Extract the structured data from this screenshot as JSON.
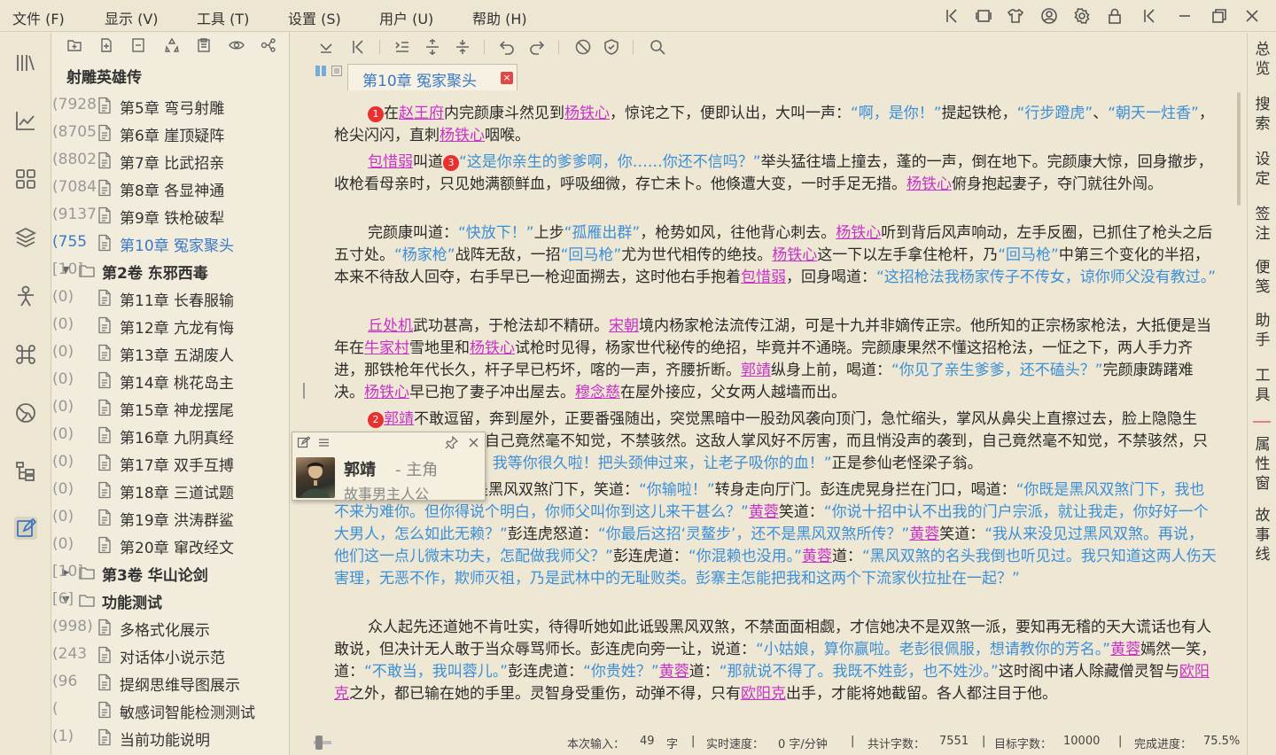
{
  "menu": [
    "文件 (F)",
    "显示 (V)",
    "工具 (T)",
    "设置 (S)",
    "用户 (U)",
    "帮助 (H)"
  ],
  "tree": {
    "title": "射雕英雄传",
    "rows": [
      {
        "label": "第5章 弯弓射雕",
        "count": "(7928",
        "type": "chapter"
      },
      {
        "label": "第6章 崖顶疑阵",
        "count": "(8705",
        "type": "chapter"
      },
      {
        "label": "第7章 比武招亲",
        "count": "(8802",
        "type": "chapter"
      },
      {
        "label": "第8章 各显神通",
        "count": "(7084",
        "type": "chapter"
      },
      {
        "label": "第9章 铁枪破犁",
        "count": "(9137",
        "type": "chapter"
      },
      {
        "label": "第10章 冤家聚头",
        "count": "(755",
        "type": "chapter",
        "selected": true
      },
      {
        "label": "第2卷 东邪西毒",
        "count": "[10]",
        "type": "volume",
        "expanded": true
      },
      {
        "label": "第11章 长春服输",
        "count": "(0)",
        "type": "chapter"
      },
      {
        "label": "第12章 亢龙有悔",
        "count": "(0)",
        "type": "chapter"
      },
      {
        "label": "第13章 五湖废人",
        "count": "(0)",
        "type": "chapter"
      },
      {
        "label": "第14章 桃花岛主",
        "count": "(0)",
        "type": "chapter"
      },
      {
        "label": "第15章 神龙摆尾",
        "count": "(0)",
        "type": "chapter"
      },
      {
        "label": "第16章 九阴真经",
        "count": "(0)",
        "type": "chapter"
      },
      {
        "label": "第17章 双手互搏",
        "count": "(0)",
        "type": "chapter"
      },
      {
        "label": "第18章 三道试题",
        "count": "(0)",
        "type": "chapter"
      },
      {
        "label": "第19章 洪涛群鲨",
        "count": "(0)",
        "type": "chapter"
      },
      {
        "label": "第20章 窜改经文",
        "count": "(0)",
        "type": "chapter"
      },
      {
        "label": "第3卷 华山论剑",
        "count": "[10]",
        "type": "volume",
        "expanded": false
      },
      {
        "label": "功能测试",
        "count": "[6]",
        "type": "volume",
        "expanded": true
      },
      {
        "label": "多格式化展示",
        "count": "(998)",
        "type": "chapter"
      },
      {
        "label": "对话体小说示范",
        "count": "(243",
        "type": "chapter"
      },
      {
        "label": "提纲思维导图展示",
        "count": "(96",
        "type": "chapter"
      },
      {
        "label": "敏感词智能检测测试",
        "count": "(",
        "type": "chapter"
      },
      {
        "label": "当前功能说明",
        "count": "(1)",
        "type": "chapter"
      }
    ]
  },
  "character_card": {
    "name": "郭靖",
    "role": "- 主角",
    "desc": "故事男主人公"
  },
  "tab": {
    "label": "第10章 冤家聚头",
    "close": "×"
  },
  "editor": {
    "paragraphs": [
      [
        [
          "b",
          "1"
        ],
        [
          "t",
          "在"
        ],
        [
          "n",
          "赵王府"
        ],
        [
          "t",
          "内完颜康斗然见到"
        ],
        [
          "n",
          "杨铁心"
        ],
        [
          "t",
          "，惊诧之下，便即认出，大叫一声："
        ],
        [
          "d",
          "“啊，是你！”"
        ],
        [
          "t",
          "提起铁枪，"
        ],
        [
          "d",
          "“行步蹬虎”"
        ],
        [
          "t",
          "、"
        ],
        [
          "d",
          "“朝天一炷香”"
        ],
        [
          "t",
          "，枪尖闪闪，直刺"
        ],
        [
          "n",
          "杨铁心"
        ],
        [
          "t",
          "咽喉。"
        ]
      ],
      [
        [
          "n",
          "包惜弱"
        ],
        [
          "t",
          "叫道"
        ],
        [
          "b",
          "3"
        ],
        [
          "d",
          "“这是你亲生的爹爹啊，你……你还不信吗？”"
        ],
        [
          "t",
          "举头猛往墙上撞去，蓬的一声，倒在地下。完颜康大惊，回身撤步，收枪看母亲时，只见她满额鲜血，呼吸细微，存亡未卜。他倏遭大变，一时手足无措。"
        ],
        [
          "n",
          "杨铁心"
        ],
        [
          "t",
          "俯身抱起妻子，夺门就往外闯。"
        ]
      ],
      [
        [
          "t",
          "完颜康叫道："
        ],
        [
          "d",
          "“快放下！”"
        ],
        [
          "t",
          "上步"
        ],
        [
          "d",
          "“孤雁出群”"
        ],
        [
          "t",
          "，枪势如风，往他背心刺去。"
        ],
        [
          "n",
          "杨铁心"
        ],
        [
          "t",
          "听到背后风声响动，左手反圈，已抓住了枪头之后五寸处。"
        ],
        [
          "d",
          "“杨家枪”"
        ],
        [
          "t",
          "战阵无敌，一招"
        ],
        [
          "d",
          "“回马枪”"
        ],
        [
          "t",
          "尤为世代相传的绝技。"
        ],
        [
          "n",
          "杨铁心"
        ],
        [
          "t",
          "这一下以左手拿住枪杆，乃"
        ],
        [
          "d",
          "“回马枪”"
        ],
        [
          "t",
          "中第三个变化的半招，本来不待敌人回夺，右手早已一枪迎面搠去，这时他右手抱着"
        ],
        [
          "n",
          "包惜弱"
        ],
        [
          "t",
          "，回身喝道："
        ],
        [
          "d",
          "“这招枪法我杨家传子不传女，谅你师父没有教过。”"
        ]
      ],
      [
        [
          "n",
          "丘处机"
        ],
        [
          "t",
          "武功甚高，于枪法却不精研。"
        ],
        [
          "n",
          "宋朝"
        ],
        [
          "t",
          "境内杨家枪法流传江湖，可是十九并非嫡传正宗。他所知的正宗杨家枪法，大抵便是当年在"
        ],
        [
          "n",
          "牛家村"
        ],
        [
          "t",
          "雪地里和"
        ],
        [
          "n",
          "杨铁心"
        ],
        [
          "t",
          "试枪时见得，杨家世代秘传的绝招，毕竟并不通晓。完颜康果然不懂这招枪法，一怔之下，两人手力齐进，那铁枪年代长久，杆子早已朽坏，喀的一声，齐腰折断。"
        ],
        [
          "n",
          "郭靖"
        ],
        [
          "t",
          "纵身上前，喝道："
        ],
        [
          "d",
          "“你见了亲生爹爹，还不磕头？”"
        ],
        [
          "t",
          "完颜康踌躇难决。"
        ],
        [
          "n",
          "杨铁心"
        ],
        [
          "t",
          "早已抱了妻子冲出屋去。"
        ],
        [
          "n",
          "穆念慈"
        ],
        [
          "t",
          "在屋外接应，父女两人越墙而出。"
        ]
      ],
      [
        [
          "b",
          "2"
        ],
        [
          "n",
          "郭靖"
        ],
        [
          "t",
          "不敢逗留，奔到屋外，正要番强随出，突觉黑暗中一股劲风袭向顶门，急忙缩头，掌风从鼻尖上直擦过去，脸上隐隐生疼，这一惊非同小可，自己竟然毫不知觉，不禁骇然。这敌人掌风好不厉害，而且悄没声的袭到，自己竟然毫不知觉，不禁骇然，只听那人喝道："
        ],
        [
          "d",
          "“浑小子，我等你很久啦！把头颈伸过来，让老子吸你的血！”"
        ],
        [
          "t",
          "正是参仙老怪梁子翁。"
        ]
      ],
      [
        [
          "t",
          "她说完，只见她是黑风双煞门下，笑道："
        ],
        [
          "d",
          "“你输啦！”"
        ],
        [
          "t",
          "转身走向厅门。彭连虎晃身拦在门口，喝道："
        ],
        [
          "d",
          "“你既是黑风双煞门下，我也不来为难你。但你得说个明白，你师父叫你到这儿来干甚么？”"
        ],
        [
          "n",
          "黄蓉"
        ],
        [
          "t",
          "笑道："
        ],
        [
          "d",
          "“你说十招中认不出我的门户宗派，就让我走，你好好一个大男人，怎么如此无赖？”"
        ],
        [
          "t",
          "彭连虎怒道："
        ],
        [
          "d",
          "“你最后这招‘灵鳌步’，还不是黑风双煞所传？”"
        ],
        [
          "n",
          "黄蓉"
        ],
        [
          "t",
          "笑道："
        ],
        [
          "d",
          "“我从来没见过黑风双煞。再说，他们这一点儿微末功夫，怎配做我师父？”"
        ],
        [
          "t",
          "彭连虎道："
        ],
        [
          "d",
          "“你混赖也没用。”"
        ],
        [
          "n",
          "黄蓉"
        ],
        [
          "t",
          "道："
        ],
        [
          "d",
          "“黑风双煞的名头我倒也听见过。我只知道这两人伤天害理，无恶不作，欺师灭祖，乃是武林中的无耻败类。彭寨主怎能把我和这两个下流家伙拉扯在一起？”"
        ]
      ],
      [
        [
          "t",
          "众人起先还道她不肯吐实，待得听她如此诋毁黑风双煞，不禁面面相觑，才信她决不是双煞一派，要知再无稽的天大谎话也有人敢说，但决计无人敢于当众辱骂师长。彭连虎向旁一让，说道："
        ],
        [
          "d",
          "“小姑娘，算你赢啦。老彭很佩服，想请教你的芳名。”"
        ],
        [
          "n",
          "黄蓉"
        ],
        [
          "t",
          "嫣然一笑，道："
        ],
        [
          "d",
          "“不敢当，我叫蓉儿。”"
        ],
        [
          "t",
          "彭连虎道："
        ],
        [
          "d",
          "“你贵姓？”"
        ],
        [
          "n",
          "黄蓉"
        ],
        [
          "t",
          "道："
        ],
        [
          "d",
          "“那就说不得了。我既不姓彭，也不姓沙。”"
        ],
        [
          "t",
          "这时阁中诸人除藏僧灵智与"
        ],
        [
          "n",
          "欧阳克"
        ],
        [
          "t",
          "之外，都已输在她的手里。灵智身受重伤，动弹不得，只有"
        ],
        [
          "n",
          "欧阳克"
        ],
        [
          "t",
          "出手，才能将她截留。各人都注目于他。"
        ]
      ]
    ]
  },
  "right_bar": [
    "总览",
    "搜索",
    "设定",
    "签注",
    "便笺",
    "助手",
    "工具",
    "属性窗",
    "故事线"
  ],
  "status": {
    "input_label": "本次输入：",
    "input_value": "49",
    "input_unit": "字",
    "speed_label": "实时速度：",
    "speed_value": "0 字/分钟",
    "total_label": "共计字数：",
    "total_value": "7551",
    "target_label": "目标字数：",
    "target_value": "10000",
    "progress_label": "完成进度：",
    "progress_value": "75.5%",
    "sep": "|"
  },
  "colors": {
    "dialogue": "#3b8fd8",
    "name": "#c832c8",
    "badge": "#e83030",
    "accent": "#3b78c6"
  }
}
